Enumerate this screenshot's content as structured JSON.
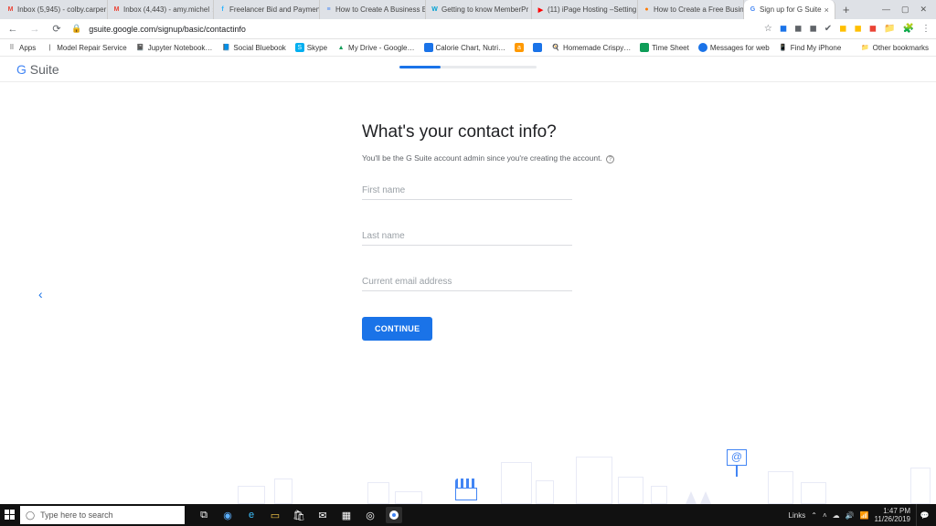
{
  "tabs": [
    {
      "fav": "M",
      "favColor": "#EA4335",
      "label": "Inbox (5,945) - colby.carper"
    },
    {
      "fav": "M",
      "favColor": "#EA4335",
      "label": "Inbox (4,443) - amy.michel"
    },
    {
      "fav": "f",
      "favColor": "#29b2fe",
      "label": "Freelancer Bid and Paymen"
    },
    {
      "fav": "≡",
      "favColor": "#4285F4",
      "label": "How to Create A Business E"
    },
    {
      "fav": "W",
      "favColor": "#00a0d2",
      "label": "Getting to know MemberPr"
    },
    {
      "fav": "▶",
      "favColor": "#ff0000",
      "label": "(11) iPage Hosting –Setting"
    },
    {
      "fav": "●",
      "favColor": "#ff7a00",
      "label": "How to Create a Free Busin"
    },
    {
      "fav": "G",
      "favColor": "#4285F4",
      "label": "Sign up for G Suite",
      "active": true
    }
  ],
  "addressbar": {
    "url": "gsuite.google.com/signup/basic/contactinfo"
  },
  "bookmarks": {
    "appsLabel": "Apps",
    "items": [
      {
        "icon": "🔧",
        "label": "Model Repair Service"
      },
      {
        "icon": "📓",
        "label": "Jupyter Notebook…"
      },
      {
        "icon": "📘",
        "label": "Social Bluebook"
      },
      {
        "icon": "S",
        "label": "Skype",
        "color": "#00aff0"
      },
      {
        "icon": "▲",
        "label": "My Drive - Google…",
        "color": "#0f9d58"
      },
      {
        "icon": "◼",
        "label": "Calorie Chart, Nutri…",
        "color": "#1a73e8"
      },
      {
        "icon": "a",
        "label": "",
        "color": "#ff9900"
      },
      {
        "icon": "◼",
        "label": "",
        "color": "#1a73e8"
      },
      {
        "icon": "🍳",
        "label": "Homemade Crispy…"
      },
      {
        "icon": "◼",
        "label": "Time Sheet",
        "color": "#0f9d58"
      },
      {
        "icon": "◼",
        "label": "Messages for web",
        "color": "#1a73e8"
      },
      {
        "icon": "📱",
        "label": "Find My iPhone"
      }
    ],
    "other": "Other bookmarks"
  },
  "brand": {
    "text": "G Suite"
  },
  "form": {
    "heading": "What's your contact info?",
    "sub": "You'll be the G Suite account admin since you're creating the account.",
    "first": "First name",
    "last": "Last name",
    "email": "Current email address",
    "continue": "CONTINUE"
  },
  "taskbar": {
    "search": "Type here to search",
    "links": "Links",
    "time": "1:47 PM",
    "date": "11/26/2019"
  }
}
